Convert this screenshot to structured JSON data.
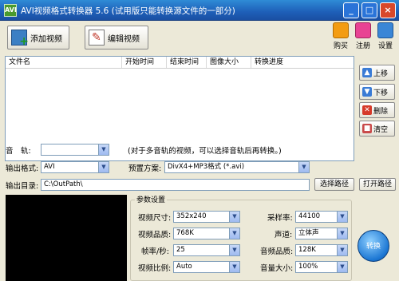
{
  "window": {
    "title": "AVI视频格式转换器 5.6 (试用版只能转换源文件的一部分)",
    "icon": "app-icon"
  },
  "toolbar": {
    "add_video": "添加视频",
    "edit_video": "编辑视频",
    "buy": "购买",
    "register": "注册",
    "settings": "设置"
  },
  "file_list": {
    "columns": [
      "文件名",
      "开始时间",
      "结束时间",
      "图像大小",
      "转换进度"
    ],
    "rows": []
  },
  "side_buttons": {
    "up": "上移",
    "down": "下移",
    "delete": "删除",
    "clear": "清空"
  },
  "audio": {
    "label": "音　轨:",
    "value": "",
    "hint": "(对于多音轨的视频，可以选择音轨后再转换。)"
  },
  "output_format": {
    "label": "输出格式:",
    "value": "AVI"
  },
  "preset": {
    "label": "预置方案:",
    "value": "DivX4+MP3格式 (*.avi)"
  },
  "output_dir": {
    "label": "输出目录:",
    "value": "C:\\OutPath\\",
    "select_button": "选择路径",
    "open_button": "打开路径"
  },
  "params": {
    "group_title": "参数设置",
    "video_size": {
      "label": "视频尺寸:",
      "value": "352x240"
    },
    "video_quality": {
      "label": "视频品质:",
      "value": "768K"
    },
    "fps": {
      "label": "帧率/秒:",
      "value": "25"
    },
    "aspect": {
      "label": "视频比例:",
      "value": "Auto"
    },
    "sample_rate": {
      "label": "采样率:",
      "value": "44100"
    },
    "channels": {
      "label": "声道:",
      "value": "立体声"
    },
    "audio_quality": {
      "label": "音频品质:",
      "value": "128K"
    },
    "volume": {
      "label": "音量大小:",
      "value": "100%"
    }
  },
  "convert": {
    "label": "转换"
  }
}
